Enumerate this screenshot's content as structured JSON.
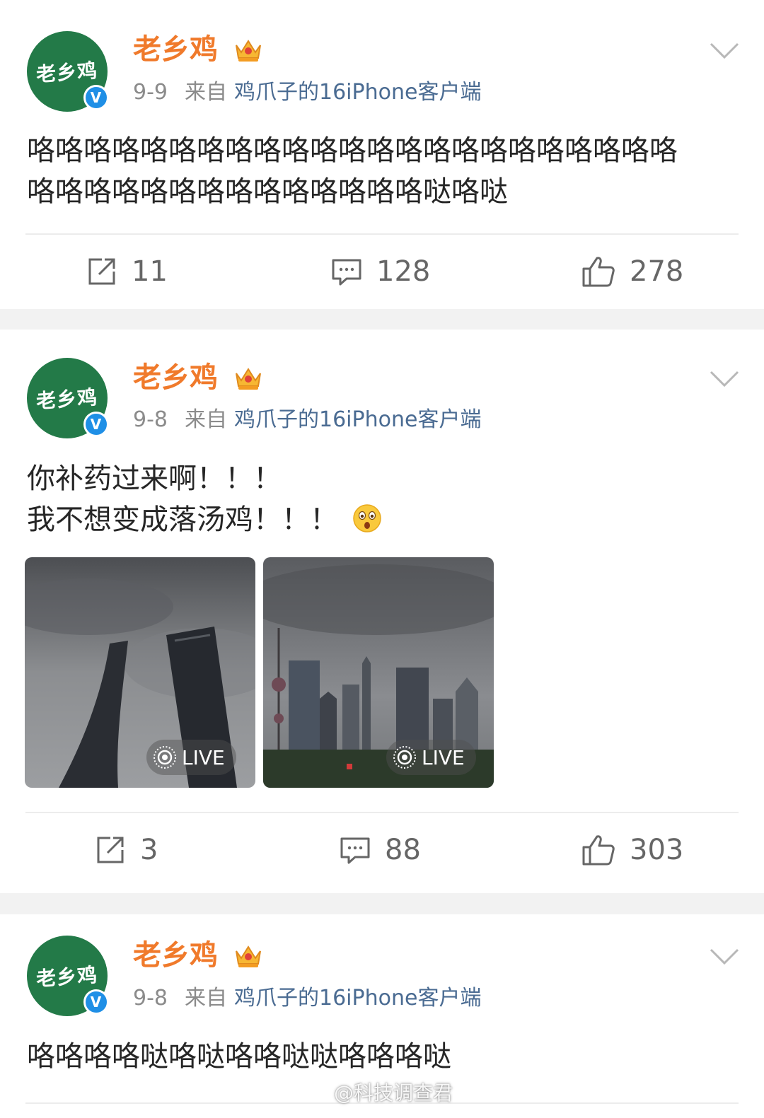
{
  "posts": [
    {
      "author": "老乡鸡",
      "avatar_text": "老乡鸡",
      "verified_mark": "V",
      "date": "9-9",
      "source_prefix": "来自",
      "source": "鸡爪子的16iPhone客户端",
      "text_lines": [
        "咯咯咯咯咯咯咯咯咯咯咯咯咯咯咯咯咯咯咯咯咯咯咯",
        "咯咯咯咯咯咯咯咯咯咯咯咯咯咯哒咯哒"
      ],
      "reposts": "11",
      "comments": "128",
      "likes": "278"
    },
    {
      "author": "老乡鸡",
      "avatar_text": "老乡鸡",
      "verified_mark": "V",
      "date": "9-8",
      "source_prefix": "来自",
      "source": "鸡爪子的16iPhone客户端",
      "text_lines": [
        "你补药过来啊！！！",
        "我不想变成落汤鸡！！！"
      ],
      "emoji": "shocked-face-emoji",
      "photos": [
        {
          "name": "shanghai-towers-photo",
          "live_label": "LIVE"
        },
        {
          "name": "lujiazui-skyline-photo",
          "live_label": "LIVE"
        }
      ],
      "reposts": "3",
      "comments": "88",
      "likes": "303"
    },
    {
      "author": "老乡鸡",
      "avatar_text": "老乡鸡",
      "verified_mark": "V",
      "date": "9-8",
      "source_prefix": "来自",
      "source": "鸡爪子的16iPhone客户端",
      "text_lines": [
        "咯咯咯咯哒咯哒咯咯哒哒咯咯咯哒"
      ]
    }
  ],
  "watermark": "@科技调查君",
  "colors": {
    "username": "#f07a2b",
    "source_link": "#4a6b92",
    "avatar_bg": "#237a48",
    "verified_badge": "#1f8fe6",
    "meta_gray": "#8b8b8b",
    "separator": "#f2f2f2"
  },
  "icons": [
    "crown-icon",
    "chevron-down-icon",
    "repost-icon",
    "comment-icon",
    "like-icon",
    "live-photo-icon",
    "weibo-logo-icon"
  ]
}
